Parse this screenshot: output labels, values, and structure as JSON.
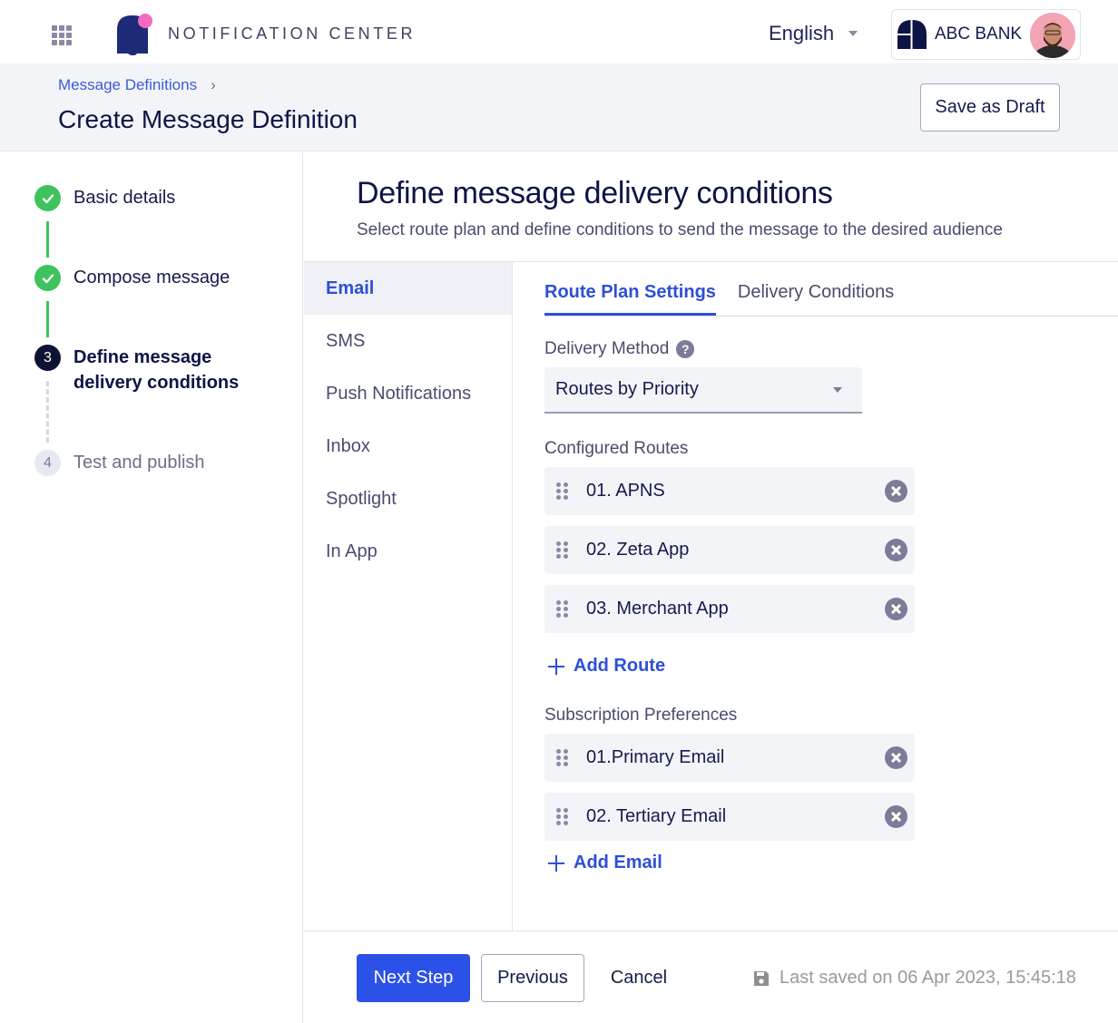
{
  "app": {
    "title": "NOTIFICATION CENTER",
    "language": "English",
    "organization": "ABC BANK"
  },
  "header": {
    "breadcrumb": [
      "Message Definitions"
    ],
    "title": "Create Message Definition",
    "save_draft_label": "Save as Draft"
  },
  "stepper": {
    "steps": [
      {
        "number": "1",
        "label": "Basic details",
        "status": "done"
      },
      {
        "number": "2",
        "label": "Compose message",
        "status": "done"
      },
      {
        "number": "3",
        "label": "Define message delivery conditions",
        "status": "active"
      },
      {
        "number": "4",
        "label": "Test and publish",
        "status": "pending"
      }
    ]
  },
  "main": {
    "title": "Define message delivery conditions",
    "subtitle": "Select route plan and define conditions to send the message to the desired audience",
    "channels": [
      {
        "label": "Email",
        "active": true
      },
      {
        "label": "SMS",
        "active": false
      },
      {
        "label": "Push Notifications",
        "active": false
      },
      {
        "label": "Inbox",
        "active": false
      },
      {
        "label": "Spotlight",
        "active": false
      },
      {
        "label": "In App",
        "active": false
      }
    ],
    "tabs": [
      {
        "label": "Route Plan Settings",
        "active": true
      },
      {
        "label": "Delivery Conditions",
        "active": false
      }
    ],
    "delivery_method": {
      "label": "Delivery Method",
      "value": "Routes by Priority"
    },
    "configured_routes": {
      "label": "Configured Routes",
      "items": [
        "01. APNS",
        "02. Zeta App",
        "03. Merchant App"
      ],
      "add_label": "Add Route"
    },
    "subscription_preferences": {
      "label": "Subscription Preferences",
      "items": [
        "01.Primary Email",
        "02. Tertiary Email"
      ],
      "add_label": "Add Email"
    }
  },
  "footer": {
    "next_label": "Next Step",
    "previous_label": "Previous",
    "cancel_label": "Cancel",
    "last_saved": "Last saved on 06 Apr 2023, 15:45:18"
  },
  "colors": {
    "accent": "#2b51e8",
    "success": "#3ec35e",
    "brand_navy": "#1e2a78",
    "brand_pink": "#f56ac1"
  }
}
